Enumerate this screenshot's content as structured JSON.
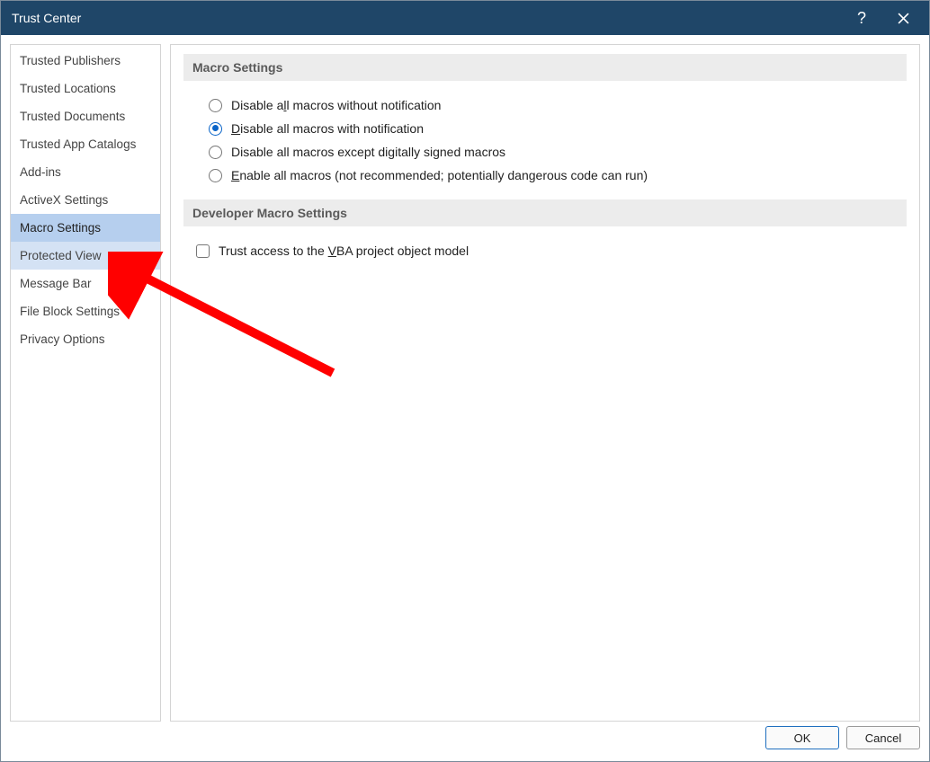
{
  "window": {
    "title": "Trust Center"
  },
  "sidebar": {
    "items": [
      {
        "label": "Trusted Publishers",
        "state": ""
      },
      {
        "label": "Trusted Locations",
        "state": ""
      },
      {
        "label": "Trusted Documents",
        "state": ""
      },
      {
        "label": "Trusted App Catalogs",
        "state": ""
      },
      {
        "label": "Add-ins",
        "state": ""
      },
      {
        "label": "ActiveX Settings",
        "state": ""
      },
      {
        "label": "Macro Settings",
        "state": "selected"
      },
      {
        "label": "Protected View",
        "state": "hover"
      },
      {
        "label": "Message Bar",
        "state": ""
      },
      {
        "label": "File Block Settings",
        "state": ""
      },
      {
        "label": "Privacy Options",
        "state": ""
      }
    ]
  },
  "sections": {
    "macro_settings_header": "Macro Settings",
    "developer_header": "Developer Macro Settings",
    "radios": {
      "opt1_pre": "Disable a",
      "opt1_u": "l",
      "opt1_post": "l macros without notification",
      "opt2_pre": "",
      "opt2_u": "D",
      "opt2_post": "isable all macros with notification",
      "opt3_pre": "Disable all macros except digitally si",
      "opt3_u": "g",
      "opt3_post": "ned macros",
      "opt4_pre": "",
      "opt4_u": "E",
      "opt4_post": "nable all macros (not recommended; potentially dangerous code can run)",
      "selected": "opt2"
    },
    "vba_checkbox_pre": "Trust access to the ",
    "vba_checkbox_u": "V",
    "vba_checkbox_post": "BA project object model"
  },
  "footer": {
    "ok": "OK",
    "cancel": "Cancel"
  }
}
